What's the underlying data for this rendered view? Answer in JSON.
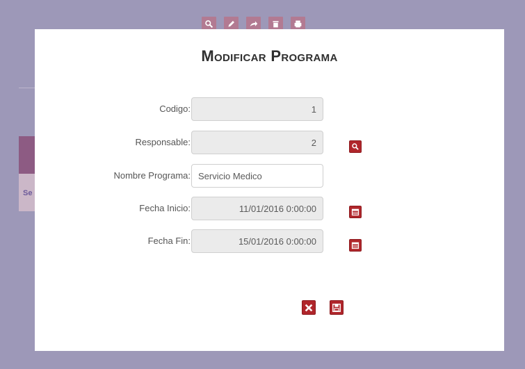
{
  "modal": {
    "title": "Modificar Programa"
  },
  "form": {
    "codigo": {
      "label": "Codigo:",
      "value": "1"
    },
    "responsable": {
      "label": "Responsable:",
      "value": "2"
    },
    "nombre_programa": {
      "label": "Nombre Programa:",
      "value": "Servicio Medico"
    },
    "fecha_inicio": {
      "label": "Fecha Inicio:",
      "value": "11/01/2016 0:00:00"
    },
    "fecha_fin": {
      "label": "Fecha Fin:",
      "value": "15/01/2016 0:00:00"
    }
  },
  "background": {
    "side_text": "Se",
    "toolbar_icons": [
      "search-icon",
      "edit-icon",
      "share-icon",
      "delete-icon",
      "print-icon"
    ]
  },
  "icons": {
    "lookup": "search-icon",
    "calendar": "calendar-icon",
    "cancel": "close-icon",
    "save": "save-icon"
  },
  "colors": {
    "accent": "#b0262b",
    "backdrop": "#9d98b8",
    "readonly_field": "#ebebeb"
  }
}
